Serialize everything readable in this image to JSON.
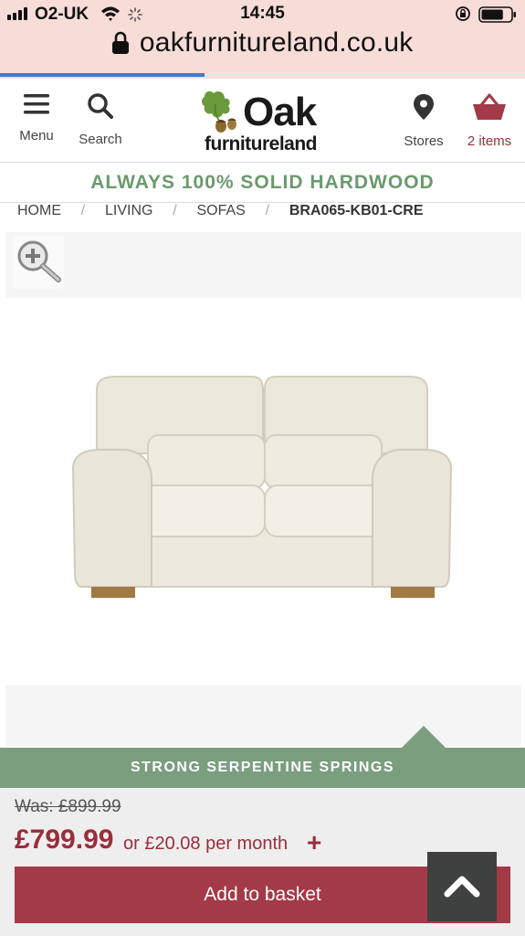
{
  "status_bar": {
    "carrier": "O2-UK",
    "time": "14:45",
    "signal_bars": 4,
    "battery_level": 0.75
  },
  "browser": {
    "url": "oakfurnitureland.co.uk",
    "load_progress": 0.39
  },
  "header": {
    "menu_label": "Menu",
    "search_label": "Search",
    "logo_primary": "Oak",
    "logo_secondary": "furnitureland",
    "stores_label": "Stores",
    "basket_label": "2 items"
  },
  "promo": {
    "text": "ALWAYS 100% SOLID HARDWOOD"
  },
  "breadcrumb": {
    "items": [
      "HOME",
      "LIVING",
      "SOFAS"
    ],
    "separator": "/",
    "current": "BRA065-KB01-CRE"
  },
  "product": {
    "feature_banner": "STRONG SERPENTINE SPRINGS",
    "was_price": "Was: £899.99",
    "now_price": "£799.99",
    "finance_text": "or £20.08 per month",
    "finance_plus": "+",
    "add_to_basket_label": "Add to basket"
  },
  "colors": {
    "brand_red": "#9b2d3c",
    "button_red": "#a33a47",
    "brand_green": "#7a9e7e",
    "promo_green": "#6a9a6d",
    "url_bar_bg": "#f7dcd8"
  },
  "icons": {
    "menu": "hamburger-icon",
    "search": "search-icon",
    "stores": "map-pin-icon",
    "basket": "basket-icon",
    "zoom": "zoom-in-icon",
    "scroll_top": "chevron-up-icon",
    "lock": "lock-icon"
  }
}
